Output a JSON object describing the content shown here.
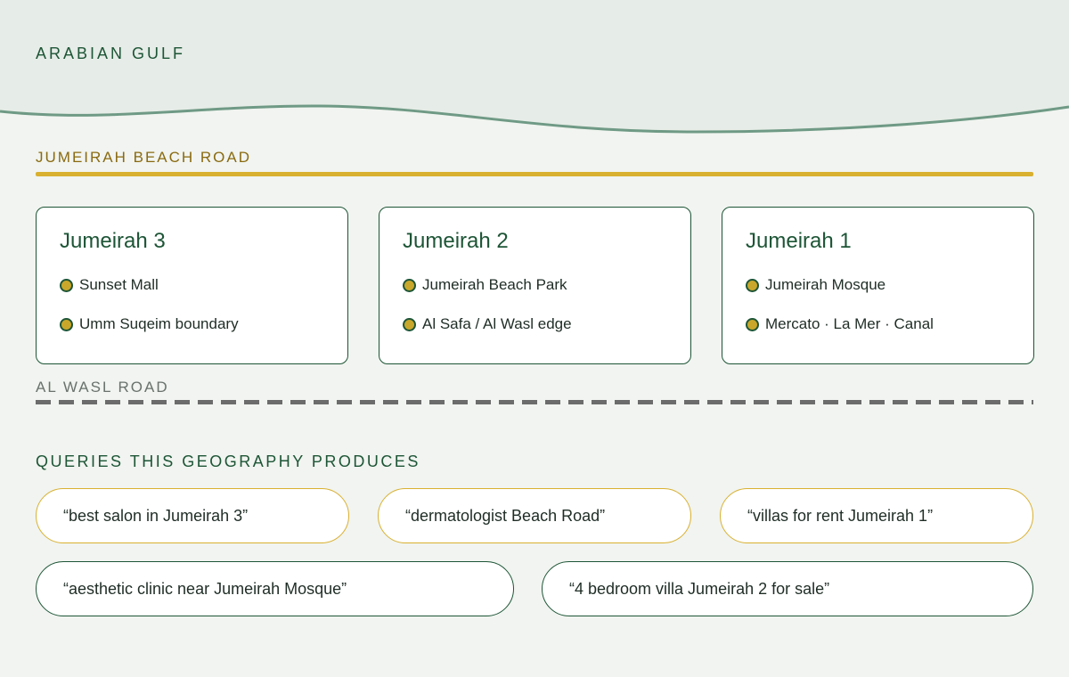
{
  "sea": {
    "label": "ARABIAN GULF"
  },
  "roads": {
    "beach_road": "JUMEIRAH BEACH ROAD",
    "al_wasl_road": "AL WASL ROAD"
  },
  "districts": [
    {
      "name": "Jumeirah 3",
      "landmarks": [
        "Sunset Mall",
        "Umm Suqeim boundary"
      ]
    },
    {
      "name": "Jumeirah 2",
      "landmarks": [
        "Jumeirah Beach Park",
        "Al Safa / Al Wasl edge"
      ]
    },
    {
      "name": "Jumeirah 1",
      "landmarks": [
        "Jumeirah Mosque",
        "Mercato · La Mer · Canal"
      ]
    }
  ],
  "queries": {
    "heading": "QUERIES THIS GEOGRAPHY PRODUCES",
    "items": [
      "“best salon in Jumeirah 3”",
      "“dermatologist Beach Road”",
      "“villas for rent Jumeirah 1”",
      "“aesthetic clinic near Jumeirah Mosque”",
      "“4 bedroom villa Jumeirah 2 for sale”"
    ]
  },
  "colors": {
    "sea": "#e6ece7",
    "coastline": "#6f9a85",
    "beach_road": "#d9b030",
    "al_wasl_road": "#6c6c6c",
    "accent_green": "#1d5536",
    "landmark_dot": "#c9a72a"
  }
}
